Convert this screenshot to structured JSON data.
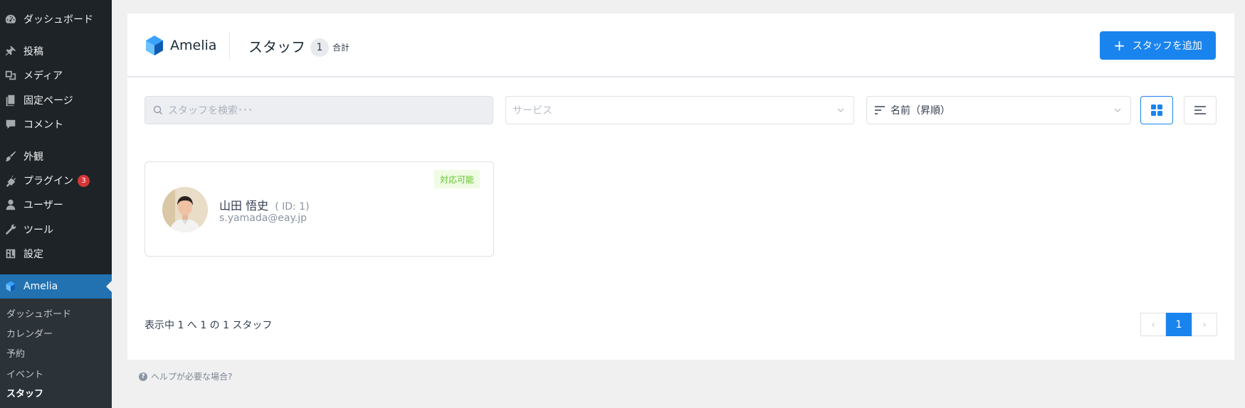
{
  "sidebar": {
    "items": [
      {
        "label": "ダッシュボード",
        "icon": "dashboard-icon"
      },
      {
        "label": "投稿",
        "icon": "pin-icon"
      },
      {
        "label": "メディア",
        "icon": "media-icon"
      },
      {
        "label": "固定ページ",
        "icon": "page-icon"
      },
      {
        "label": "コメント",
        "icon": "comment-icon"
      },
      {
        "label": "外観",
        "icon": "brush-icon"
      },
      {
        "label": "プラグイン",
        "icon": "plugin-icon",
        "badge": "3"
      },
      {
        "label": "ユーザー",
        "icon": "user-icon"
      },
      {
        "label": "ツール",
        "icon": "wrench-icon"
      },
      {
        "label": "設定",
        "icon": "settings-icon"
      }
    ],
    "active_plugin": {
      "label": "Amelia",
      "icon": "amelia-icon"
    },
    "submenu": [
      "ダッシュボード",
      "カレンダー",
      "予約",
      "イベント",
      "スタッフ"
    ]
  },
  "header": {
    "logo_text": "Amelia",
    "title": "スタッフ",
    "count": "1",
    "count_label": "合計",
    "add_button_label": "スタッフを追加"
  },
  "filters": {
    "search_placeholder": "スタッフを検索･･･",
    "service_placeholder": "サービス",
    "sort_value": "名前（昇順）"
  },
  "employees": [
    {
      "name": "山田 悟史",
      "id_label": "( ID: 1)",
      "email": "s.yamada@eay.jp",
      "status": "対応可能"
    }
  ],
  "pagination": {
    "info": "表示中 1 へ 1 の 1 スタッフ",
    "current": "1",
    "prev": "‹",
    "next": "›"
  },
  "help_text": "ヘルプが必要な場合?",
  "colors": {
    "accent": "#1a84ee",
    "wp_sidebar": "#1d2327",
    "wp_active": "#2271b1",
    "available": "#62c42d"
  }
}
